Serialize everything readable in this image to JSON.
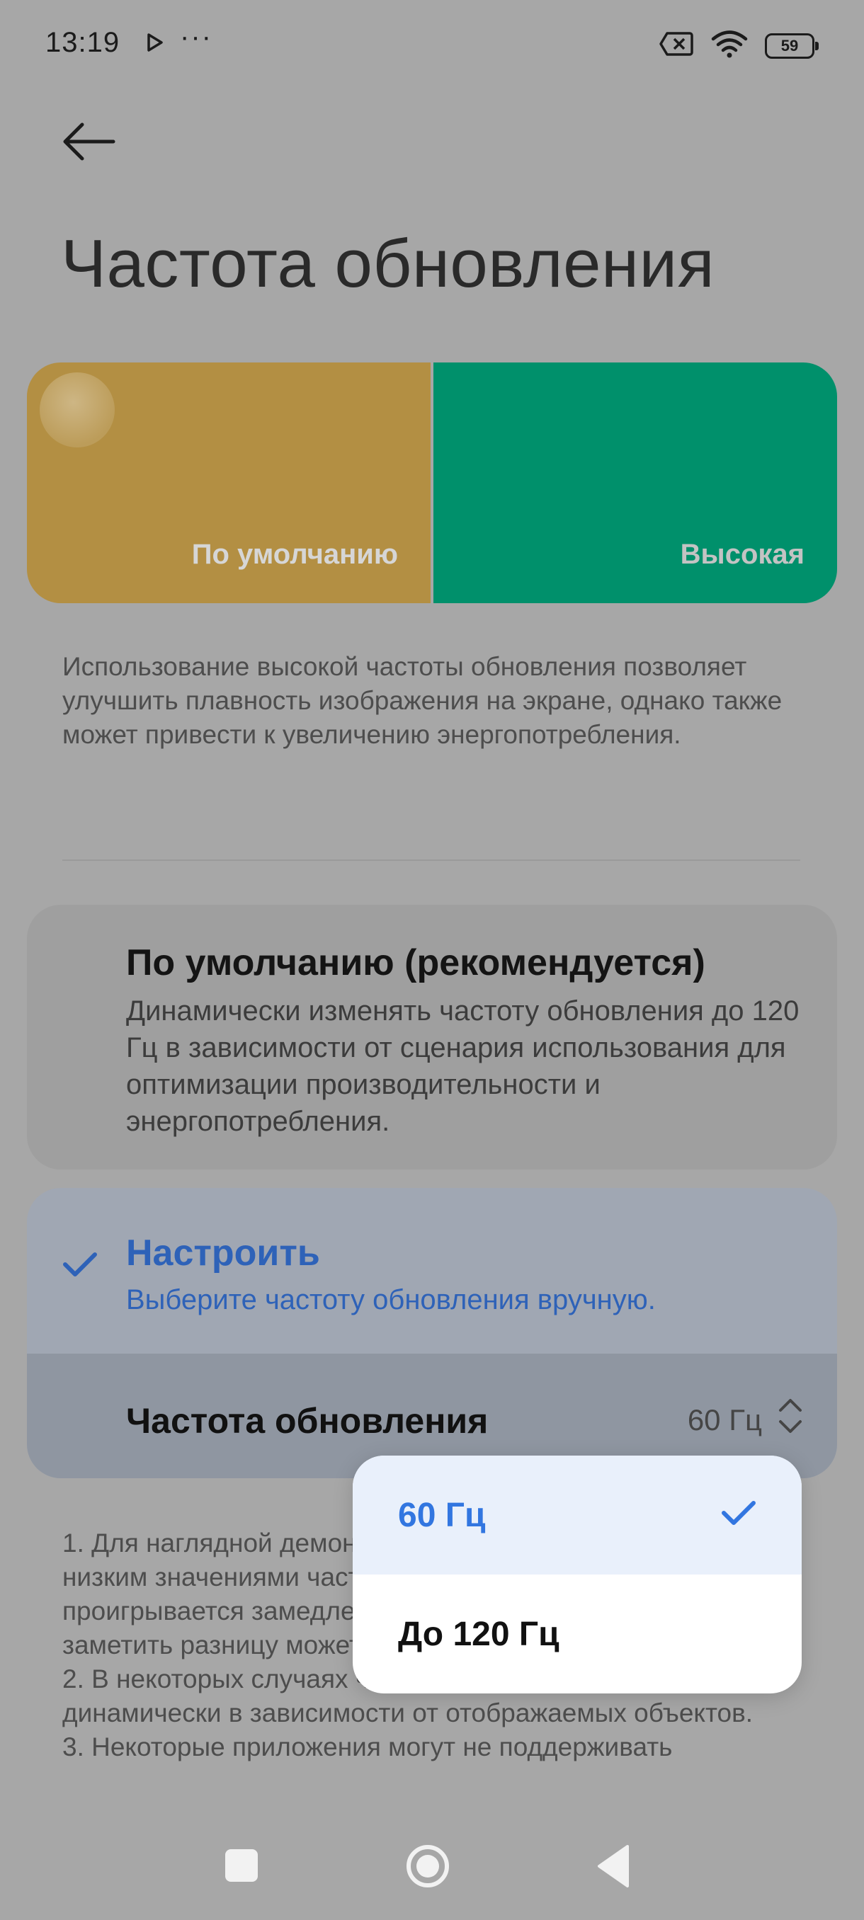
{
  "status_bar": {
    "time": "13:19",
    "more": "···",
    "battery_level": "59"
  },
  "header": {
    "title": "Частота обновления"
  },
  "modes": {
    "default_label": "По умолчанию",
    "high_label": "Высокая",
    "default_color": "#b38f43",
    "high_color": "#00906b"
  },
  "description": "Использование высокой частоты обновления позволяет улучшить плавность изображения на экране, однако также может привести к увеличению энергопотребления.",
  "options": {
    "default": {
      "title": "По умолчанию (рекомендуется)",
      "subtitle": "Динамически изменять частоту обновления до 120 Гц в зависимости от сценария использования для оптимизации производительности и энергопотребления."
    },
    "custom": {
      "title": "Настроить",
      "subtitle": "Выберите частоту обновления вручную.",
      "selected": true
    },
    "refresh_row": {
      "label": "Частота обновления",
      "value": "60 Гц"
    }
  },
  "notes": "1. Для наглядной демонстрации разницы между высоким и низким значениями частоты обновления экрана видео проигрывается замедленно. При обычном использовании заметить разницу может быть труднее.\n2. В некоторых случаях частота обновления меняется динамически в зависимости от отображаемых объектов.\n3. Некоторые приложения могут не поддерживать",
  "dropdown": {
    "items": [
      {
        "label": "60 Гц",
        "selected": true
      },
      {
        "label": "До 120 Гц",
        "selected": false
      }
    ]
  },
  "colors": {
    "accent": "#3276e0"
  },
  "icons": {
    "back": "back-arrow-icon",
    "check": "checkmark-icon",
    "updown": "chevron-up-down-icon"
  }
}
